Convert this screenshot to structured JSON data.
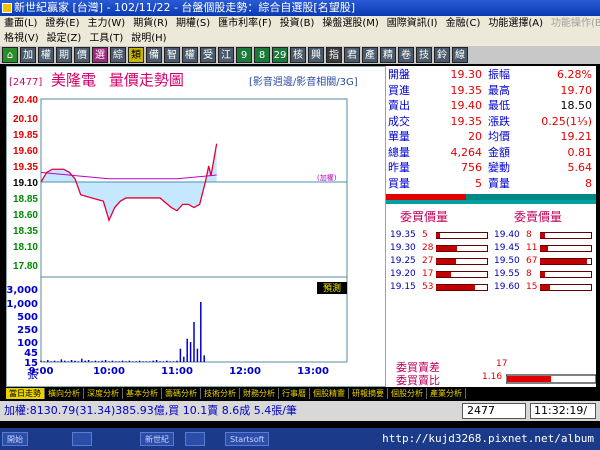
{
  "window": {
    "title": "新世紀贏家 [台灣] - 102/11/22 - 台盤個股走勢：綜合自選股[名望股]"
  },
  "menu": {
    "row1": [
      "畫面(L)",
      "證券(E)",
      "主力(W)",
      "期貨(R)",
      "期權(S)",
      "匯市利率(F)",
      "投資(B)",
      "操盤選股(M)",
      "國際資訊(I)",
      "金融(C)",
      "功能選擇(A)",
      "功能操作(B)"
    ],
    "row1_disabled": [
      false,
      false,
      false,
      false,
      false,
      false,
      false,
      false,
      false,
      false,
      false,
      true
    ],
    "row2": [
      "格視(V)",
      "設定(Z)",
      "工具(T)",
      "說明(H)"
    ]
  },
  "toolbar": [
    "⌂",
    "加",
    "權",
    "期",
    "價",
    "選",
    "綜",
    "類",
    "備",
    "智",
    "權",
    "受",
    "江",
    "9",
    "8",
    "29",
    "核",
    "興",
    "指",
    "君",
    "產",
    "精",
    "卷",
    "技",
    "鈴",
    "線"
  ],
  "chart": {
    "stock_code": "[2477]",
    "stock_name": "美隆電",
    "chart_name": "量價走勢圖",
    "subtitle": "[影音週邊/影音相關/3G]",
    "ref_label": "(加權)",
    "forecast_label": "預測",
    "zhang_label": "張",
    "price_ticks": [
      "20.40",
      "20.10",
      "19.85",
      "19.60",
      "19.35",
      "19.10",
      "18.85",
      "18.60",
      "18.35",
      "18.10",
      "17.80"
    ],
    "ref_tick": "19.10",
    "volume_ticks": [
      "3,000",
      "1,000",
      "500",
      "250",
      "100",
      "45",
      "15"
    ],
    "time_ticks": [
      "9:00",
      "10:00",
      "11:00",
      "12:00",
      "13:00"
    ]
  },
  "chart_data": {
    "type": "line",
    "x_axis": "time",
    "xlim": [
      "9:00",
      "13:30"
    ],
    "ylim": [
      17.8,
      20.4
    ],
    "ref_price": 19.1,
    "series": [],
    "price_x": [
      "9:00",
      "9:05",
      "9:10",
      "9:15",
      "9:20",
      "9:25",
      "9:30",
      "9:35",
      "9:45",
      "9:55",
      "10:00",
      "10:05",
      "10:10",
      "10:15",
      "10:25",
      "10:35",
      "10:45",
      "10:55",
      "11:00",
      "11:05",
      "11:10",
      "11:15",
      "11:20",
      "11:25",
      "11:28",
      "11:30",
      "11:33",
      "11:35"
    ],
    "price_y": [
      19.1,
      19.25,
      19.3,
      19.3,
      19.3,
      19.25,
      19.15,
      18.9,
      18.85,
      18.8,
      18.5,
      18.7,
      18.8,
      18.85,
      18.85,
      18.85,
      18.85,
      18.7,
      18.65,
      18.75,
      18.75,
      18.7,
      18.75,
      19.1,
      19.35,
      19.2,
      19.5,
      19.7
    ],
    "avg_x": [
      "9:00",
      "9:30",
      "10:00",
      "10:30",
      "11:00",
      "11:30",
      "11:35"
    ],
    "avg_y": [
      19.25,
      19.2,
      19.15,
      19.15,
      19.15,
      19.2,
      19.21
    ],
    "volume": [
      2,
      1,
      3,
      1,
      2,
      1,
      4,
      2,
      1,
      3,
      2,
      1,
      5,
      2,
      3,
      1,
      2,
      1,
      2,
      3,
      1,
      2,
      1,
      1,
      2,
      1,
      2,
      1,
      1,
      2,
      1,
      1,
      1,
      2,
      3,
      1,
      1,
      2,
      1,
      1,
      2,
      20,
      8,
      35,
      30,
      60,
      20,
      90,
      10
    ],
    "volume_start": "9:00",
    "volume_step_min": 3
  },
  "quote": {
    "rows": [
      {
        "l": "開盤",
        "v": "19.30",
        "l2": "振幅",
        "v2": "6.28%",
        "c1": "red",
        "c2": "red"
      },
      {
        "l": "買進",
        "v": "19.35",
        "l2": "最高",
        "v2": "19.70",
        "c1": "red",
        "c2": "red"
      },
      {
        "l": "賣出",
        "v": "19.40",
        "l2": "最低",
        "v2": "18.50",
        "c1": "red",
        "c2": "blk"
      },
      {
        "l": "成交",
        "v": "19.35",
        "l2": "漲跌",
        "v2": "0.25(1⅓)",
        "c1": "red",
        "c2": "red"
      },
      {
        "l": "單量",
        "v": "20",
        "l2": "均價",
        "v2": "19.21",
        "c1": "red",
        "c2": "red"
      },
      {
        "l": "總量",
        "v": "4,264",
        "l2": "金額",
        "v2": "0.81",
        "c1": "red",
        "c2": "red"
      },
      {
        "l": "昨量",
        "v": "756",
        "l2": "變動",
        "v2": "5.64",
        "c1": "red",
        "c2": "red"
      },
      {
        "l": "買量",
        "v": "5",
        "l2": "賣量",
        "v2": "8",
        "c1": "red",
        "c2": "red"
      }
    ]
  },
  "orderbook": {
    "bid_header": "委買價量",
    "ask_header": "委賣價量",
    "bids": [
      {
        "p": "19.35",
        "n": "5"
      },
      {
        "p": "19.30",
        "n": "28"
      },
      {
        "p": "19.25",
        "n": "27"
      },
      {
        "p": "19.20",
        "n": "17"
      },
      {
        "p": "19.15",
        "n": "53"
      }
    ],
    "bid_fill": [
      0.08,
      0.4,
      0.38,
      0.28,
      0.75
    ],
    "asks": [
      {
        "p": "19.40",
        "n": "8"
      },
      {
        "p": "19.45",
        "n": "11"
      },
      {
        "p": "19.50",
        "n": "67"
      },
      {
        "p": "19.55",
        "n": "8"
      },
      {
        "p": "19.60",
        "n": "15"
      }
    ],
    "ask_fill": [
      0.1,
      0.15,
      0.9,
      0.1,
      0.2
    ],
    "diff_label": "委買賣差",
    "diff_value": "17",
    "ratio_label": "委買賣比",
    "ratio_value": "1.16"
  },
  "tabs": [
    "當日走勢",
    "橫向分析",
    "深度分析",
    "基本分析",
    "籌碼分析",
    "技術分析",
    "財務分析",
    "行事曆",
    "個股精靈",
    "研報摘要",
    "個股分析",
    "產業分析"
  ],
  "status": {
    "ticker": "加權:8130.79(31.34)385.93億,買 10.1賣 8.6成 5.4張/筆",
    "symbol": "2477",
    "time": "11:32:19/"
  },
  "taskbar": {
    "items": [
      "開始",
      "",
      "新世紀",
      "",
      "Startsoft",
      "",
      "",
      ""
    ],
    "url": "http://kujd3268.pixnet.net/album"
  },
  "colors": {
    "price_line": "#e0003a",
    "avg_line": "#c000c0",
    "fill": "#bfe6ff",
    "volume": "#0000c8",
    "ref_line": "#4a90b0"
  }
}
